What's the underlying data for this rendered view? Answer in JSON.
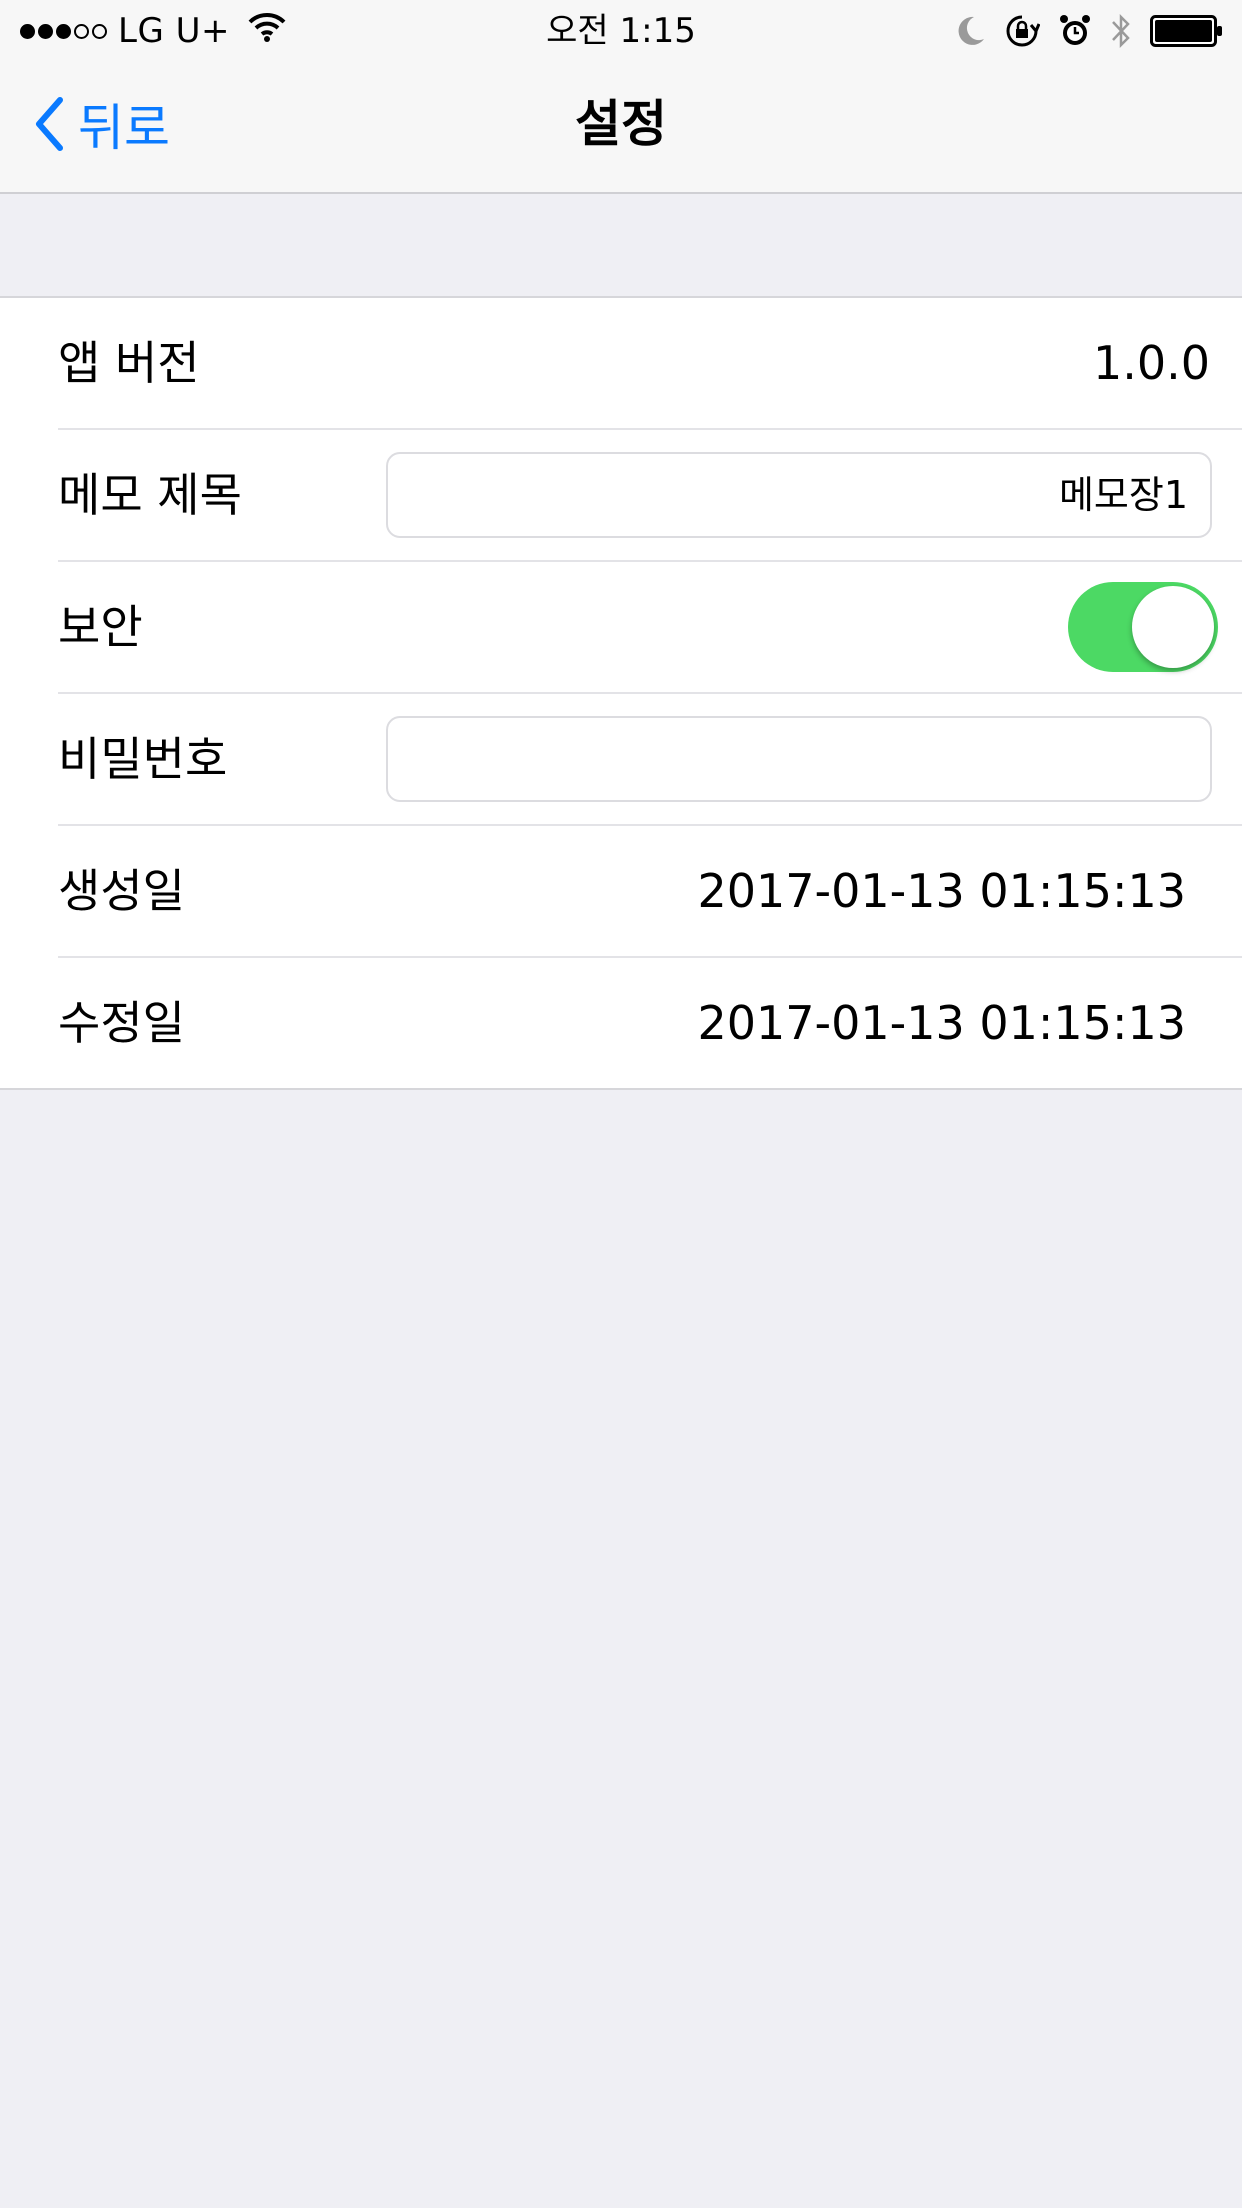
{
  "status_bar": {
    "carrier": "LG U+",
    "time": "오전 1:15",
    "signal_bars_filled": 3,
    "signal_bars_total": 5,
    "icons": [
      "wifi-icon",
      "moon-icon",
      "rotation-lock-icon",
      "alarm-icon",
      "bluetooth-icon",
      "battery-icon"
    ]
  },
  "nav": {
    "back_label": "뒤로",
    "title": "설정",
    "accent_color": "#0a7aff"
  },
  "settings": {
    "app_version_label": "앱 버전",
    "app_version_value": "1.0.0",
    "memo_title_label": "메모 제목",
    "memo_title_value": "메모장1",
    "security_label": "보안",
    "security_on": true,
    "password_label": "비밀번호",
    "password_value": "",
    "created_label": "생성일",
    "created_value": "2017-01-13 01:15:13",
    "modified_label": "수정일",
    "modified_value": "2017-01-13 01:15:13",
    "toggle_color": "#4cd964"
  }
}
